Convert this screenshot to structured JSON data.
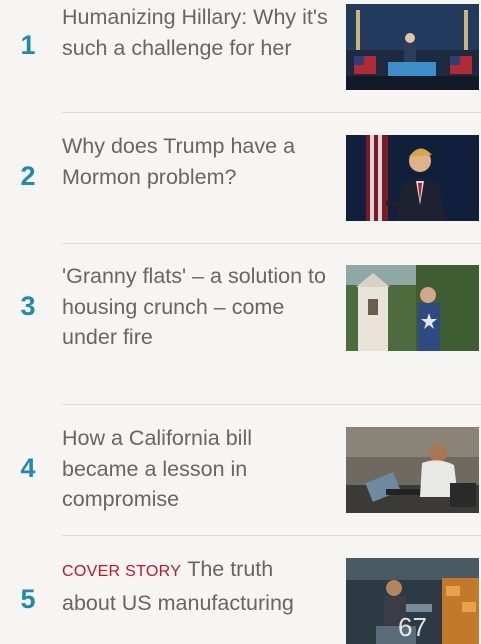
{
  "stories": [
    {
      "rank": "1",
      "headline": "Humanizing Hillary: Why it's such a challenge for her",
      "image": "rally-podium-flags-photo"
    },
    {
      "rank": "2",
      "headline": "Why does Trump have a Mormon problem?",
      "image": "speaker-with-flag-photo"
    },
    {
      "rank": "3",
      "headline": "'Granny flats' – a solution to housing crunch – come under fire",
      "image": "man-at-cottage-photo"
    },
    {
      "rank": "4",
      "headline": "How a California bill became a lesson in compromise",
      "image": "man-at-laptop-photo"
    },
    {
      "rank": "5",
      "tag": "COVER STORY",
      "headline": "The truth about US manufacturing",
      "image": "factory-worker-photo"
    }
  ],
  "overlay": {
    "page_number": "67"
  },
  "colors": {
    "rank": "#1f8bb2",
    "headline": "#666666",
    "tag": "#c4162a",
    "background": "#f6f5f1"
  }
}
